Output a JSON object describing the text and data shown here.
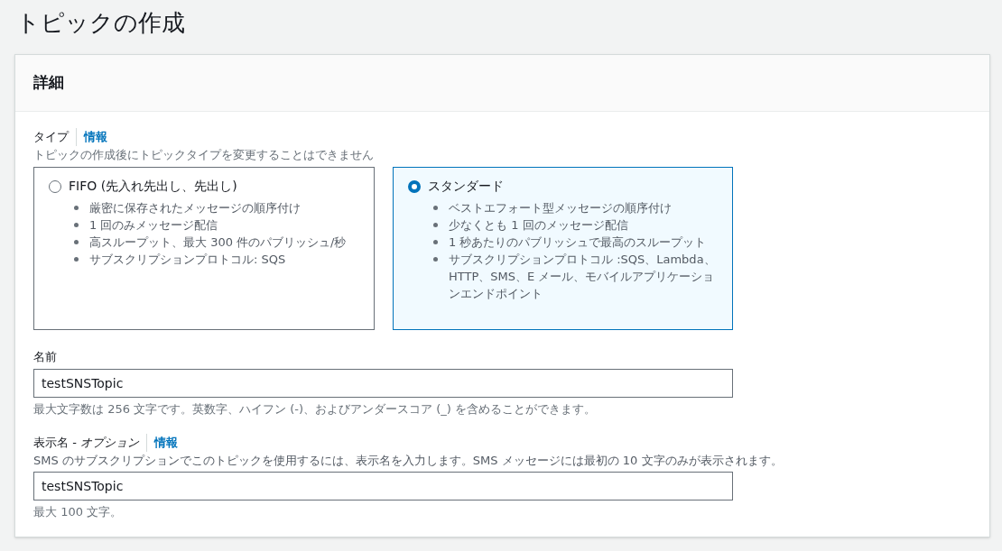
{
  "page": {
    "title": "トピックの作成"
  },
  "panel": {
    "title": "詳細",
    "type_field": {
      "label": "タイプ",
      "info": "情報",
      "description": "トピックの作成後にトピックタイプを変更することはできません",
      "options": [
        {
          "label": "FIFO (先入れ先出し、先出し)",
          "selected": false,
          "features": [
            "厳密に保存されたメッセージの順序付け",
            "1 回のみメッセージ配信",
            "高スループット、最大 300 件のパブリッシュ/秒",
            "サブスクリプションプロトコル: SQS"
          ]
        },
        {
          "label": "スタンダード",
          "selected": true,
          "features": [
            "ベストエフォート型メッセージの順序付け",
            "少なくとも 1 回のメッセージ配信",
            "1 秒あたりのパブリッシュで最高のスループット",
            "サブスクリプションプロトコル :SQS、Lambda、HTTP、SMS、E メール、モバイルアプリケーションエンドポイント"
          ]
        }
      ]
    },
    "fields": [
      {
        "label": "名前",
        "value": "testSNSTopic",
        "hint": "最大文字数は 256 文字です。英数字、ハイフン (-)、およびアンダースコア (_) を含めることができます。"
      },
      {
        "label": "表示名 - *オプション*",
        "info": "情報",
        "description": "SMS のサブスクリプションでこのトピックを使用するには、表示名を入力します。SMS メッセージには最初の 10 文字のみが表示されます。",
        "value": "testSNSTopic",
        "hint": "最大 100 文字。"
      }
    ]
  }
}
